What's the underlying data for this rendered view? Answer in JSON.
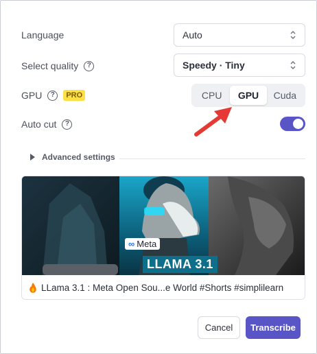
{
  "form": {
    "language_label": "Language",
    "language_value": "Auto",
    "quality_label": "Select quality",
    "quality_value": "Speedy · Tiny",
    "gpu_label": "GPU",
    "pro_badge": "PRO",
    "gpu_options": [
      "CPU",
      "GPU",
      "Cuda"
    ],
    "gpu_selected": "GPU",
    "autocut_label": "Auto cut",
    "autocut_on": true,
    "advanced_label": "Advanced settings"
  },
  "video": {
    "thumb_logo": "Meta",
    "thumb_title": "LLAMA 3.1",
    "caption": "LLama 3.1 : Meta Open Sou...e World #Shorts #simplilearn",
    "caption_icon": "fire-icon"
  },
  "actions": {
    "cancel": "Cancel",
    "transcribe": "Transcribe"
  },
  "colors": {
    "accent": "#5a55c7",
    "pro_badge": "#fde047",
    "arrow": "#e53935"
  }
}
